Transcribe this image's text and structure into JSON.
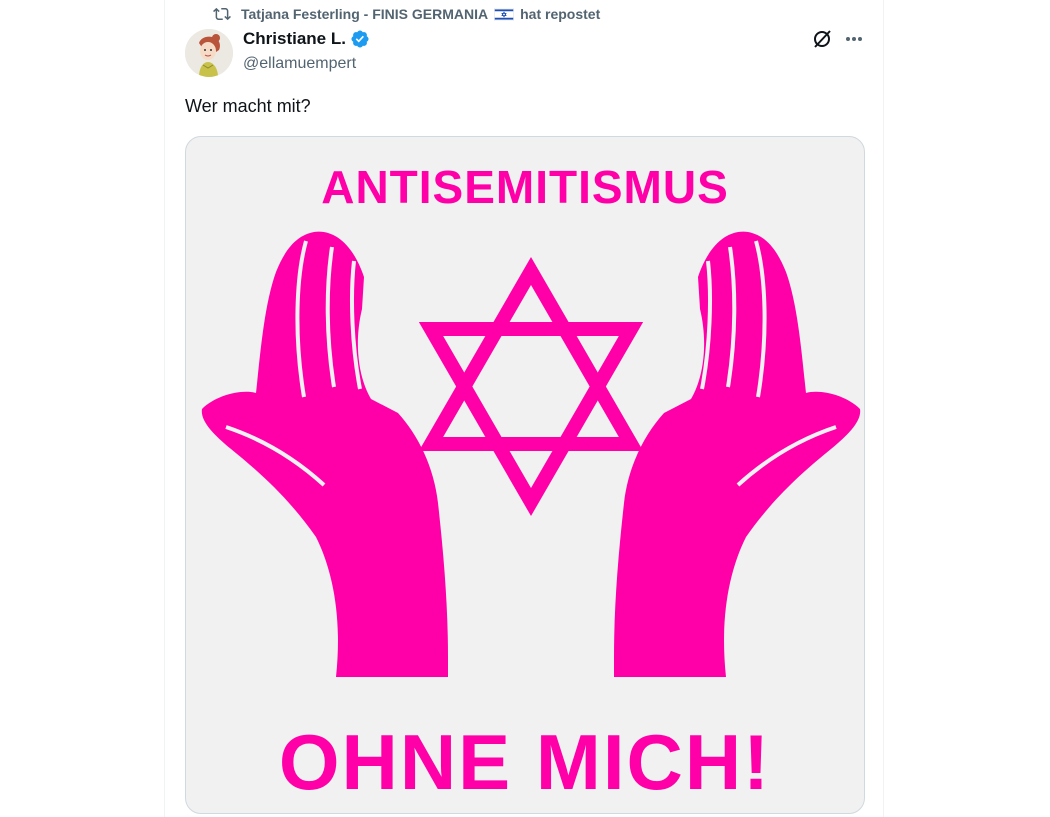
{
  "repost": {
    "icon": "repost-icon",
    "reposter_name": "Tatjana Festerling - FINIS GERMANIA",
    "flag": "israel-flag",
    "suffix": "hat repostet"
  },
  "author": {
    "name": "Christiane L.",
    "handle": "@ellamuempert",
    "verified": true,
    "avatar": "avatar-illustration"
  },
  "actions": {
    "grok_icon": "grok-icon",
    "more_icon": "more-icon"
  },
  "tweet": {
    "text": "Wer macht mit?"
  },
  "media": {
    "headline": "ANTISEMITISMUS",
    "footline": "OHNE MICH!",
    "accent_color": "#ff00a8",
    "background_color": "#f1f1f1",
    "symbols": [
      "star-of-david",
      "open-hands"
    ]
  }
}
